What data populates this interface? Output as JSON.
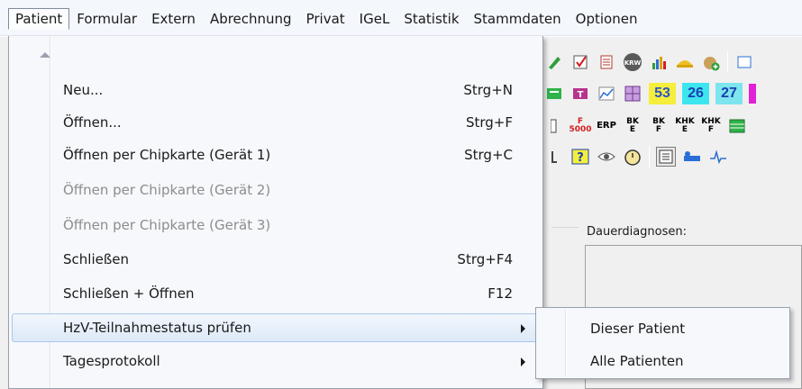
{
  "menubar": {
    "items": [
      "Patient",
      "Formular",
      "Extern",
      "Abrechnung",
      "Privat",
      "IGeL",
      "Statistik",
      "Stammdaten",
      "Optionen"
    ]
  },
  "toolbar": {
    "row4_numbers": [
      "53",
      "26",
      "27"
    ],
    "row5_labels": [
      "ERP",
      "BK E",
      "BK F",
      "KHK E",
      "KHK F"
    ],
    "krw_label": "KRW",
    "bk_f_small": "F 5000"
  },
  "panel": {
    "dauerdiagnosen_label": "Dauerdiagnosen:"
  },
  "patient_menu": {
    "items": [
      {
        "label": "Neu...",
        "accel": "Strg+N",
        "enabled": true,
        "submenu": false
      },
      {
        "label": "Öffnen...",
        "accel": "Strg+F",
        "enabled": true,
        "submenu": false
      },
      {
        "label": "Öffnen per Chipkarte (Gerät 1)",
        "accel": "Strg+C",
        "enabled": true,
        "submenu": false
      },
      {
        "label": "Öffnen per Chipkarte (Gerät 2)",
        "accel": "",
        "enabled": false,
        "submenu": false
      },
      {
        "label": "Öffnen per Chipkarte (Gerät 3)",
        "accel": "",
        "enabled": false,
        "submenu": false
      },
      {
        "label": "Schließen",
        "accel": "Strg+F4",
        "enabled": true,
        "submenu": false
      },
      {
        "label": "Schließen + Öffnen",
        "accel": "F12",
        "enabled": true,
        "submenu": false
      },
      {
        "label": "HzV-Teilnahmestatus prüfen",
        "accel": "",
        "enabled": true,
        "submenu": true
      },
      {
        "label": "Tagesprotokoll",
        "accel": "",
        "enabled": true,
        "submenu": true
      }
    ]
  },
  "hzv_submenu": {
    "items": [
      "Dieser Patient",
      "Alle Patienten"
    ]
  },
  "colors": {
    "menu_bg": "#f6f8fb",
    "highlight_border": "#a8c6ec",
    "disabled_text": "#8d8d8d"
  }
}
